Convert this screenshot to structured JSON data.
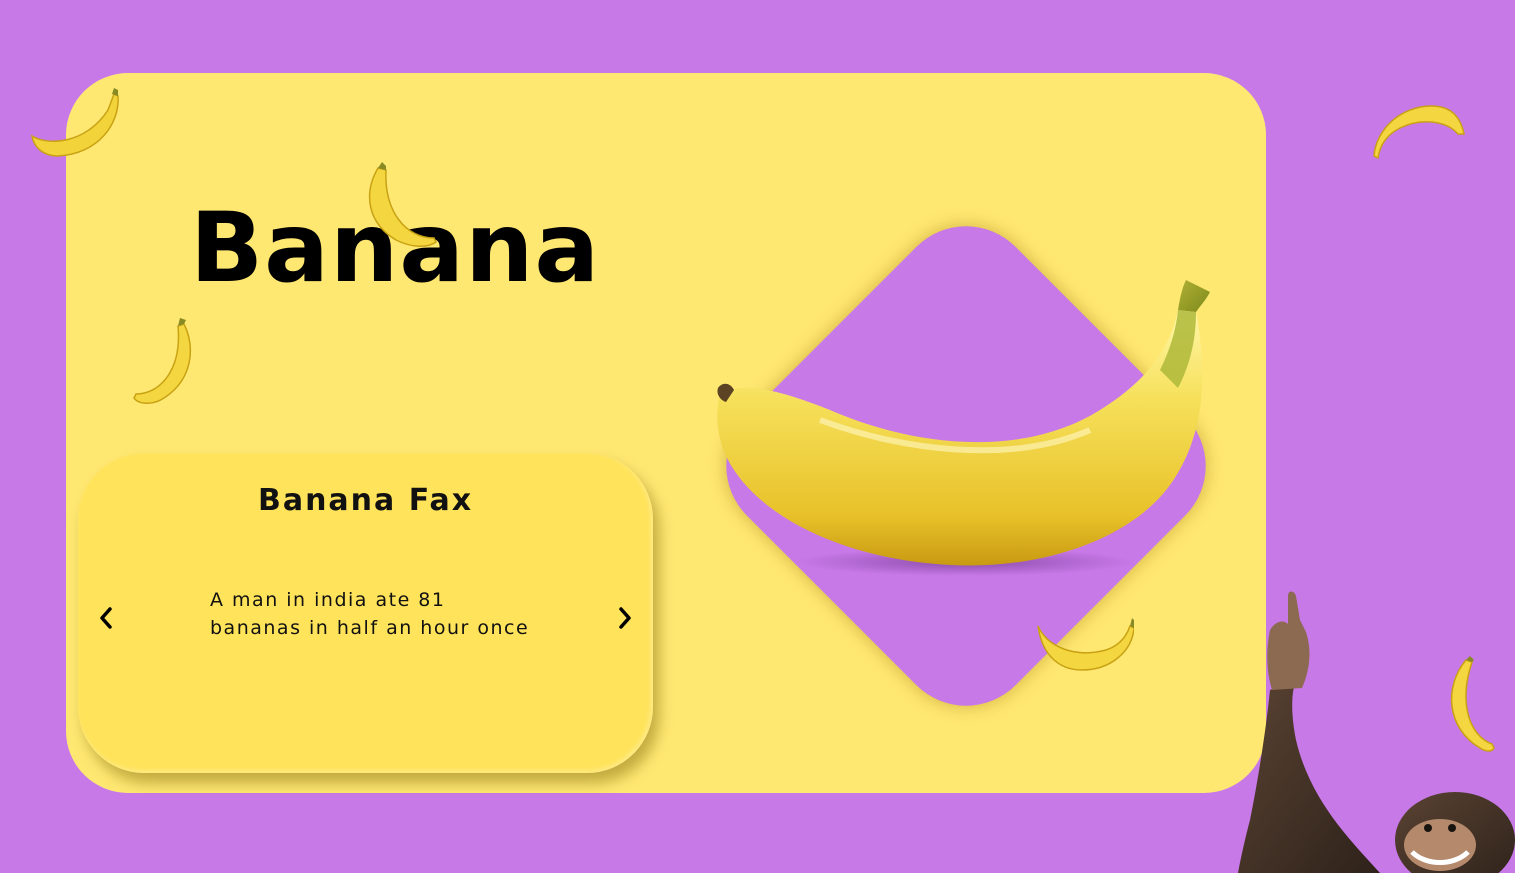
{
  "page": {
    "title": "Banana"
  },
  "fax": {
    "heading": "Banana Fax",
    "text": "A man in india ate 81 bananas in half an hour once",
    "prev_icon": "chevron-left-icon",
    "next_icon": "chevron-right-icon"
  },
  "colors": {
    "background": "#c879e8",
    "card": "#ffe872",
    "panel": "#ffe35a",
    "text": "#000000",
    "banana": "#f4d93a"
  }
}
